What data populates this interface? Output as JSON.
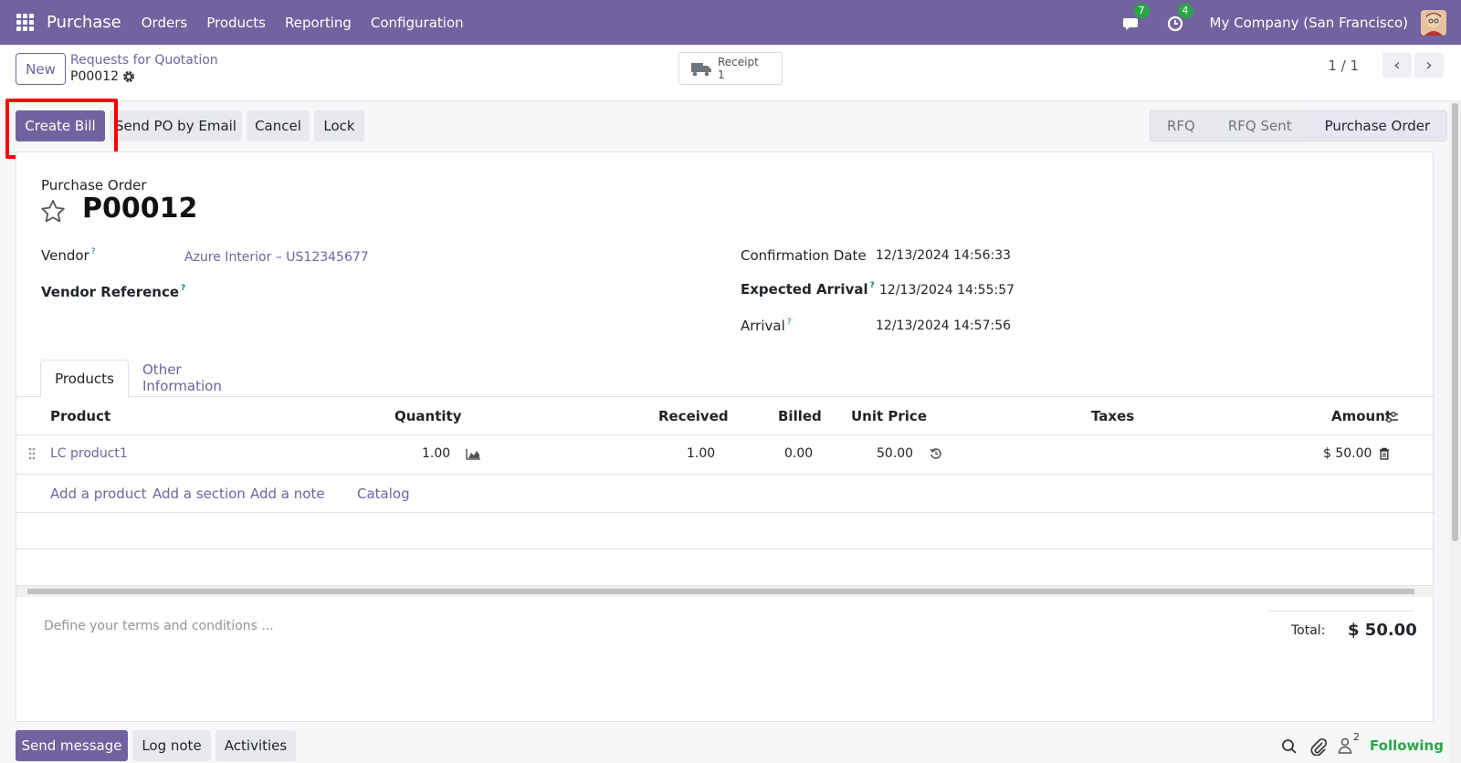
{
  "topbar": {
    "app_name": "Purchase",
    "menu": [
      "Orders",
      "Products",
      "Reporting",
      "Configuration"
    ],
    "messages_count": "7",
    "activities_count": "4",
    "company": "My Company (San Francisco)"
  },
  "control": {
    "new_label": "New",
    "breadcrumb_parent": "Requests for Quotation",
    "breadcrumb_current": "P00012",
    "receipt_label": "Receipt",
    "receipt_count": "1",
    "pager": "1 / 1"
  },
  "actions": {
    "create_bill": "Create Bill",
    "send_po": "Send PO by Email",
    "cancel": "Cancel",
    "lock": "Lock"
  },
  "status": {
    "stages": [
      "RFQ",
      "RFQ Sent",
      "Purchase Order"
    ],
    "active_stage": "Purchase Order"
  },
  "form": {
    "doc_type": "Purchase Order",
    "name": "P00012",
    "vendor_label": "Vendor",
    "vendor_value": "Azure Interior – US12345677",
    "vendor_ref_label": "Vendor Reference",
    "confirmation_date_label": "Confirmation Date",
    "confirmation_date_value": "12/13/2024 14:56:33",
    "expected_arrival_label": "Expected Arrival",
    "expected_arrival_value": "12/13/2024 14:55:57",
    "arrival_label": "Arrival",
    "arrival_value": "12/13/2024 14:57:56",
    "help_mark": "?"
  },
  "tabs": [
    "Products",
    "Other Information"
  ],
  "table": {
    "headers": {
      "product": "Product",
      "quantity": "Quantity",
      "received": "Received",
      "billed": "Billed",
      "unit_price": "Unit Price",
      "taxes": "Taxes",
      "amount": "Amount"
    },
    "rows": [
      {
        "product": "LC product1",
        "quantity": "1.00",
        "received": "1.00",
        "billed": "0.00",
        "unit_price": "50.00",
        "taxes": "",
        "amount": "$ 50.00"
      }
    ],
    "add_links": [
      "Add a product",
      "Add a section",
      "Add a note",
      "Catalog"
    ]
  },
  "footer": {
    "terms_placeholder": "Define your terms and conditions ...",
    "total_label": "Total:",
    "total_value": "$ 50.00"
  },
  "chatter": {
    "send_message": "Send message",
    "log_note": "Log note",
    "activities": "Activities",
    "followers_count": "2",
    "following": "Following"
  },
  "colors": {
    "brand": "#71639e",
    "highlight": "#ff0000",
    "following": "#28a745"
  }
}
